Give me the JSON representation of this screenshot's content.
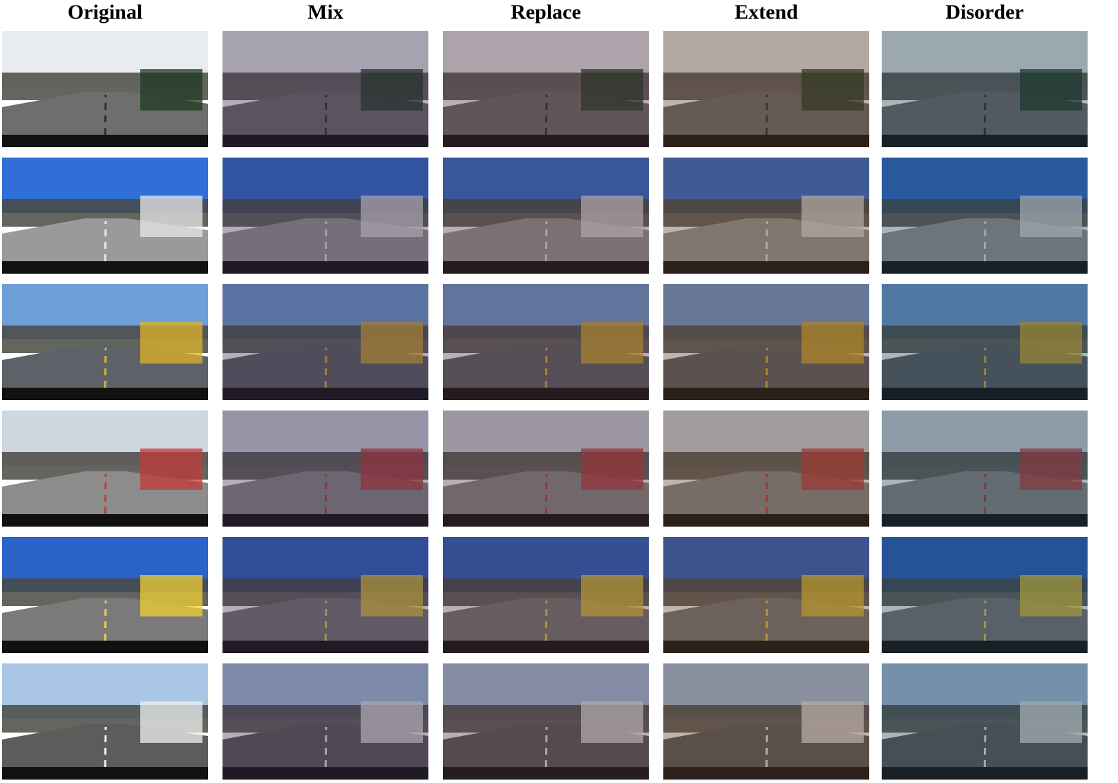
{
  "columns": [
    {
      "label": "Original",
      "style": "original"
    },
    {
      "label": "Mix",
      "style": "mix"
    },
    {
      "label": "Replace",
      "style": "replace"
    },
    {
      "label": "Extend",
      "style": "extend"
    },
    {
      "label": "Disorder",
      "style": "disorder"
    }
  ],
  "rows": [
    {
      "scene": "garbage-truck-street",
      "sky": "#e9ecef",
      "road": "#6e6e6e",
      "accent": "#1f3a22"
    },
    {
      "scene": "highway-dump-truck",
      "sky": "#2f6fd6",
      "road": "#9a9a9a",
      "accent": "#e8e8e8"
    },
    {
      "scene": "shop-street-yellow-lines",
      "sky": "#6f9fd8",
      "road": "#5d6168",
      "accent": "#e0b32a"
    },
    {
      "scene": "curving-road-palm-trees",
      "sky": "#cfd7e0",
      "road": "#8c8c8c",
      "accent": "#c23a3a"
    },
    {
      "scene": "intersection-traffic-lights",
      "sky": "#2b63c9",
      "road": "#7a7a7a",
      "accent": "#f2d033"
    },
    {
      "scene": "white-suv-crosswalk",
      "sky": "#a9c6e6",
      "road": "#5c5c5c",
      "accent": "#f0f0f0"
    }
  ],
  "tints": {
    "original": "#000000",
    "mix": "#3a2a4a",
    "replace": "#4a2f3a",
    "extend": "#5a3a2a",
    "disorder": "#203a4a"
  }
}
